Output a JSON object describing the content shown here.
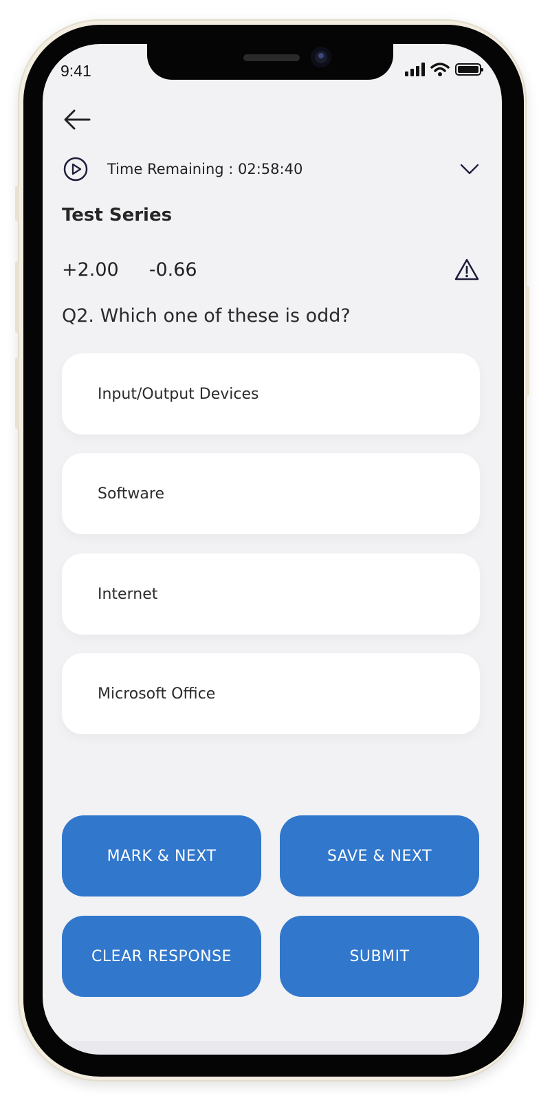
{
  "status_bar": {
    "time": "9:41"
  },
  "header": {
    "timer_text": "Time Remaining : 02:58:40"
  },
  "test": {
    "title": "Test Series",
    "positive_marks": "+2.00",
    "negative_marks": "-0.66"
  },
  "question": {
    "text": "Q2. Which one of these is odd?",
    "options": [
      {
        "label": "Input/Output Devices"
      },
      {
        "label": "Software"
      },
      {
        "label": "Internet"
      },
      {
        "label": "Microsoft Office"
      }
    ]
  },
  "actions": {
    "mark_next": "MARK & NEXT",
    "save_next": "SAVE & NEXT",
    "clear_response": "CLEAR RESPONSE",
    "submit": "SUBMIT"
  },
  "colors": {
    "button_blue": "#3177cc",
    "screen_background": "#f2f2f5",
    "option_background": "#ffffff",
    "frame": "#f3ede0"
  },
  "icons": [
    "back-arrow-icon",
    "play-circle-icon",
    "chevron-down-icon",
    "warning-icon",
    "signal-icon",
    "wifi-icon",
    "battery-icon"
  ]
}
